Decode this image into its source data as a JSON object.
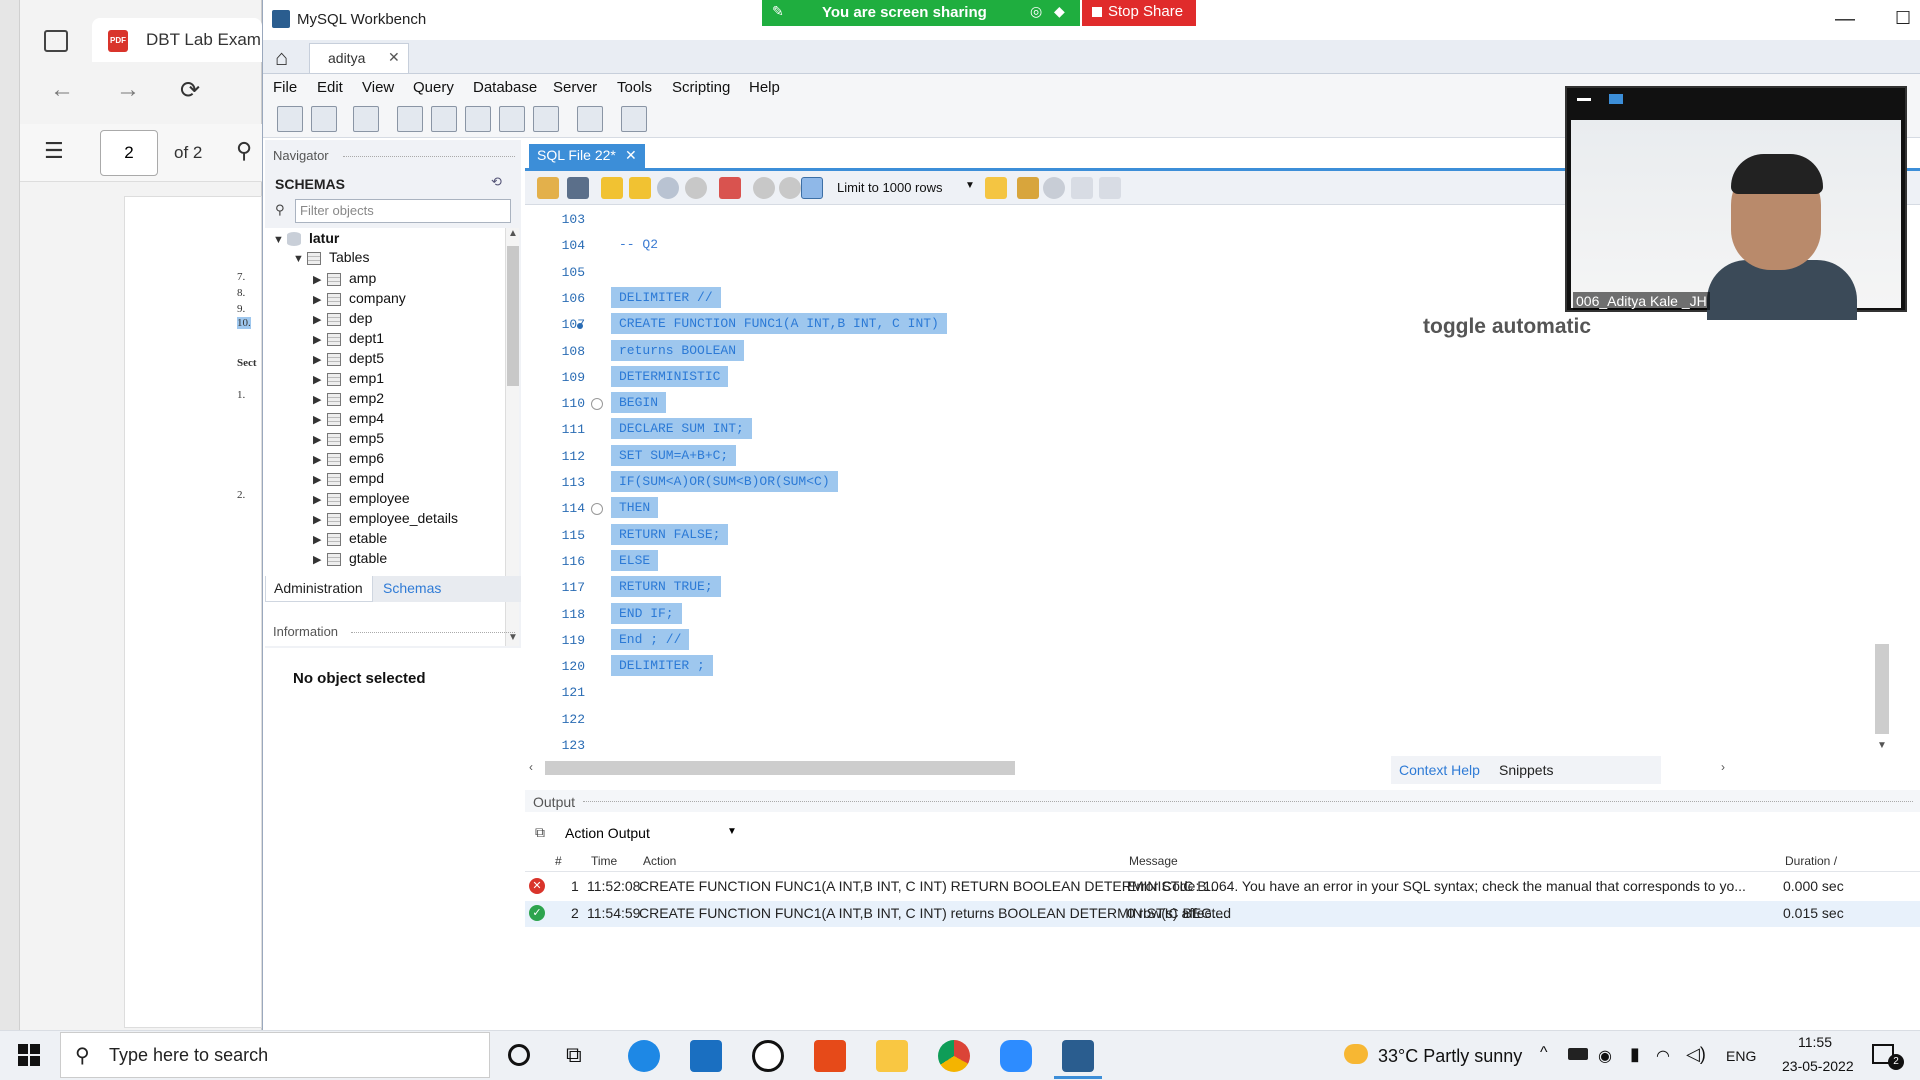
{
  "browser": {
    "tab_title": "DBT Lab Exam",
    "pdf_icon": "PDF",
    "page_current": "2",
    "page_total": "of 2",
    "doc_lines": [
      "7.",
      "8.",
      "9.",
      "10.",
      "Sect",
      "1.",
      "2."
    ]
  },
  "window": {
    "title": "MySQL Workbench",
    "connection_tab": "aditya"
  },
  "screen_share": {
    "status": "You are screen sharing",
    "stop_label": "Stop Share"
  },
  "menu": [
    "File",
    "Edit",
    "View",
    "Query",
    "Database",
    "Server",
    "Tools",
    "Scripting",
    "Help"
  ],
  "navigator": {
    "header": "Navigator",
    "schemas_label": "SCHEMAS",
    "filter_placeholder": "Filter objects",
    "schema_name": "latur",
    "tables_label": "Tables",
    "tables": [
      "amp",
      "company",
      "dep",
      "dept1",
      "dept5",
      "emp1",
      "emp2",
      "emp4",
      "emp5",
      "emp6",
      "empd",
      "employee",
      "employee_details",
      "etable",
      "gtable"
    ],
    "tab_admin": "Administration",
    "tab_schemas": "Schemas",
    "info_header": "Information",
    "no_object": "No object selected"
  },
  "editor": {
    "tab_label": "SQL File 22*",
    "limit_label": "Limit to 1000 rows",
    "lines": [
      {
        "n": "103",
        "code": "",
        "selected": false
      },
      {
        "n": "104",
        "code": "-- Q2",
        "selected": false
      },
      {
        "n": "105",
        "code": "",
        "selected": false
      },
      {
        "n": "106",
        "code": "DELIMITER //",
        "selected": true
      },
      {
        "n": "107",
        "code": "CREATE FUNCTION FUNC1(A INT,B INT, C INT)",
        "selected": true
      },
      {
        "n": "108",
        "code": "returns BOOLEAN",
        "selected": true
      },
      {
        "n": "109",
        "code": "DETERMINISTIC",
        "selected": true
      },
      {
        "n": "110",
        "code": "BEGIN",
        "selected": true
      },
      {
        "n": "111",
        "code": "DECLARE SUM INT;",
        "selected": true
      },
      {
        "n": "112",
        "code": "SET SUM=A+B+C;",
        "selected": true
      },
      {
        "n": "113",
        "code": "IF(SUM<A)OR(SUM<B)OR(SUM<C)",
        "selected": true
      },
      {
        "n": "114",
        "code": "THEN",
        "selected": true
      },
      {
        "n": "115",
        "code": "RETURN FALSE;",
        "selected": true
      },
      {
        "n": "116",
        "code": "ELSE",
        "selected": true
      },
      {
        "n": "117",
        "code": "RETURN TRUE;",
        "selected": true
      },
      {
        "n": "118",
        "code": "END IF;",
        "selected": true
      },
      {
        "n": "119",
        "code": "End ; //",
        "selected": true
      },
      {
        "n": "120",
        "code": "DELIMITER ;",
        "selected": true
      },
      {
        "n": "121",
        "code": "",
        "selected": false
      },
      {
        "n": "122",
        "code": "",
        "selected": false
      },
      {
        "n": "123",
        "code": "",
        "selected": false
      }
    ]
  },
  "right_panel": {
    "partial_text": "toggle automatic",
    "tab_context": "Context Help",
    "tab_snippets": "Snippets"
  },
  "video": {
    "participant": "006_Aditya Kale _JH"
  },
  "output": {
    "header": "Output",
    "select_label": "Action Output",
    "columns": [
      "#",
      "Time",
      "Action",
      "Message",
      "Duration /"
    ],
    "rows": [
      {
        "status": "error",
        "num": "1",
        "time": "11:52:08",
        "action": "CREATE FUNCTION FUNC1(A INT,B INT, C INT)   RETURN BOOLEAN   DETERMINISTIC   B...",
        "message": "Error Code: 1064. You have an error in your SQL syntax; check the manual that corresponds to yo...",
        "duration": "0.000 sec"
      },
      {
        "status": "ok",
        "num": "2",
        "time": "11:54:59",
        "action": "CREATE FUNCTION FUNC1(A INT,B INT, C INT)   returns BOOLEAN   DETERMINISTIC   BEG...",
        "message": "0 row(s) affected",
        "duration": "0.015 sec"
      }
    ]
  },
  "taskbar": {
    "search_placeholder": "Type here to search",
    "weather": "33°C  Partly sunny",
    "lang": "ENG",
    "time": "11:55",
    "date": "23-05-2022",
    "notification_count": "2"
  },
  "colors": {
    "accent": "#3c8ed8",
    "selection": "#9ec7ee",
    "share_green": "#1fae3f",
    "stop_red": "#e02b2b"
  }
}
